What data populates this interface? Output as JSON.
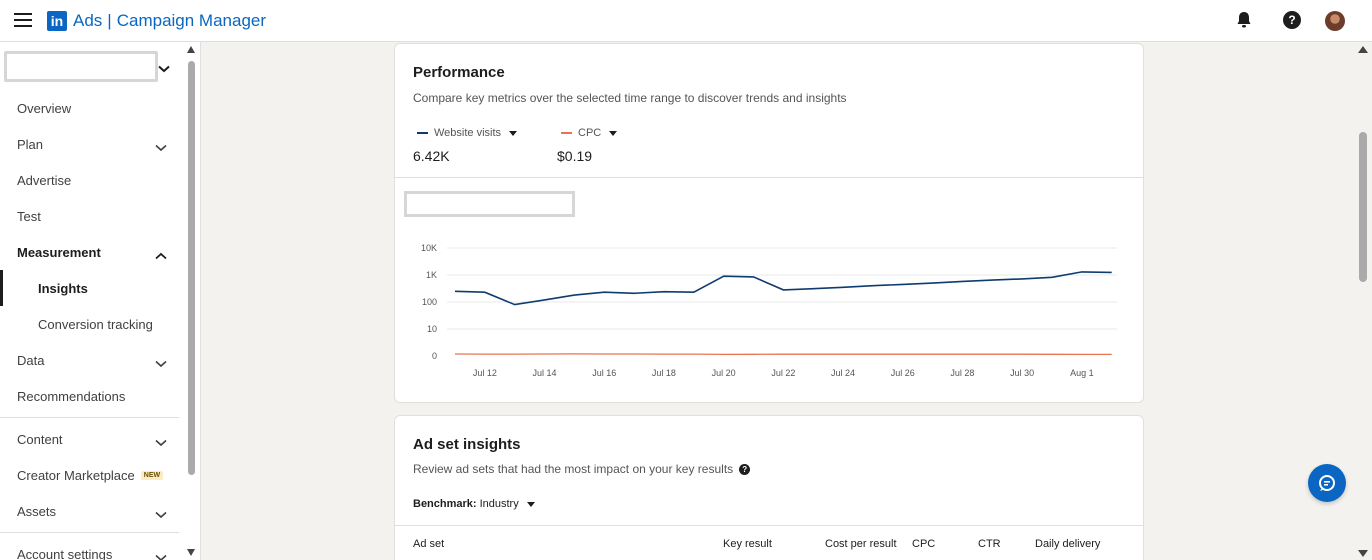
{
  "header": {
    "logo_letters": "in",
    "brand_ads": "Ads",
    "brand_separator": "|",
    "brand_product": "Campaign Manager"
  },
  "sidebar": {
    "account_placeholder": "",
    "items": [
      {
        "label": "Overview"
      },
      {
        "label": "Plan"
      },
      {
        "label": "Advertise"
      },
      {
        "label": "Test"
      },
      {
        "label": "Measurement"
      },
      {
        "label": "Insights"
      },
      {
        "label": "Conversion tracking"
      },
      {
        "label": "Data"
      },
      {
        "label": "Recommendations"
      },
      {
        "label": "Content"
      },
      {
        "label": "Creator Marketplace",
        "badge": "NEW"
      },
      {
        "label": "Assets"
      },
      {
        "label": "Account settings"
      }
    ]
  },
  "performance": {
    "title": "Performance",
    "subtitle": "Compare key metrics over the selected time range to discover trends and insights",
    "metrics": [
      {
        "name": "Website visits",
        "value": "6.42K",
        "color": "#0e3c6e"
      },
      {
        "name": "CPC",
        "value": "$0.19",
        "color": "#e8734f"
      }
    ]
  },
  "chart_data": {
    "type": "line",
    "y_axis": {
      "scale": "log",
      "tick_labels": [
        "10K",
        "1K",
        "100",
        "10",
        "0"
      ]
    },
    "x_tick_labels": [
      "Jul 12",
      "Jul 14",
      "Jul 16",
      "Jul 18",
      "Jul 20",
      "Jul 22",
      "Jul 24",
      "Jul 26",
      "Jul 28",
      "Jul 30",
      "Aug 1"
    ],
    "x": [
      "Jul 11",
      "Jul 12",
      "Jul 13",
      "Jul 14",
      "Jul 15",
      "Jul 16",
      "Jul 17",
      "Jul 18",
      "Jul 19",
      "Jul 20",
      "Jul 21",
      "Jul 22",
      "Jul 23",
      "Jul 24",
      "Jul 25",
      "Jul 26",
      "Jul 27",
      "Jul 28",
      "Jul 29",
      "Jul 30",
      "Jul 31",
      "Aug 1",
      "Aug 2"
    ],
    "series": [
      {
        "name": "Website visits",
        "color": "#0e3c6e",
        "values": [
          250,
          230,
          80,
          120,
          180,
          230,
          210,
          240,
          230,
          900,
          850,
          280,
          310,
          350,
          400,
          450,
          500,
          580,
          650,
          720,
          820,
          1300,
          1250
        ]
      },
      {
        "name": "CPC",
        "color": "#e8734f",
        "values": [
          0.2,
          0.19,
          0.19,
          0.2,
          0.21,
          0.2,
          0.2,
          0.19,
          0.19,
          0.16,
          0.17,
          0.18,
          0.18,
          0.18,
          0.18,
          0.18,
          0.18,
          0.18,
          0.18,
          0.18,
          0.17,
          0.16,
          0.16
        ]
      }
    ],
    "grid": true,
    "legend": "top-left"
  },
  "adset": {
    "title": "Ad set insights",
    "subtitle": "Review ad sets that had the most impact on your key results",
    "benchmark_label": "Benchmark:",
    "benchmark_value": "Industry",
    "columns": [
      "Ad set",
      "Key result",
      "Cost per result",
      "CPC",
      "CTR",
      "Daily delivery"
    ]
  }
}
